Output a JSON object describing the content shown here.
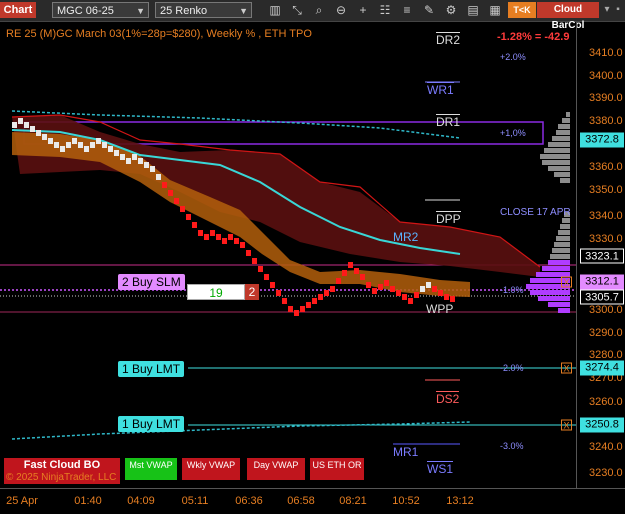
{
  "toolbar": {
    "chart_tab": "Chart",
    "instrument": "MGC 06-25",
    "bar_type": "25 Renko",
    "tko_label": "T<K",
    "cloud_label": "Cloud BarCol",
    "icons": [
      "bar-type-icon",
      "draw-icon",
      "magnifier-icon",
      "zoom-out-icon",
      "add-icon",
      "properties-icon",
      "list-icon",
      "pencil-icon",
      "strategy-icon",
      "templates-icon",
      "grid-icon",
      "chart-trader-icon"
    ]
  },
  "chart": {
    "title": "RE 25 (M)GC March 03(1%=28p=$280), Weekly % , ETH TPO",
    "pct_change": "-1.28% = -42.9",
    "close_label": "CLOSE 17 APR",
    "mr2_label": "MR2",
    "levels": {
      "dr2": "DR2",
      "wr1": "WR1",
      "dr1": "DR1",
      "dpp": "DPP",
      "wpp": "WPP",
      "ds2": "DS2",
      "mr1": "MR1",
      "ws1": "WS1"
    },
    "pct_levels": {
      "p2": "+2.0%",
      "p1": "+1,0%",
      "m1": "-1.0%",
      "m2": "-2.0%",
      "m3": "-3.0%"
    }
  },
  "price_axis": {
    "ticks": [
      "3410.0",
      "3400.0",
      "3390.0",
      "3380.0",
      "3370.0",
      "3360.0",
      "3350.0",
      "3340.0",
      "3330.0",
      "3310.0",
      "3300.0",
      "3290.0",
      "3280.0",
      "3270.0",
      "3260.0",
      "3240.0",
      "3230.0"
    ],
    "boxes": {
      "last": "3372.8",
      "hi": "3323.1",
      "cur": "3312.1",
      "lo": "3305.7",
      "lmt1": "3274.4",
      "lmt2": "3250.8"
    }
  },
  "time_axis": [
    "25 Apr",
    "01:40",
    "04:09",
    "05:11",
    "06:36",
    "06:58",
    "08:21",
    "10:52",
    "13:12"
  ],
  "orders": {
    "slm": "2 Buy SLM",
    "lmt1": "1 Buy LMT",
    "lmt2": "1 Buy LMT",
    "qty": "19",
    "qty_close": "2",
    "x": "X"
  },
  "bottom_buttons": {
    "fast_cloud": "Fast Cloud BO",
    "mst": "Mst VWAP",
    "wkly": "Wkly VWAP",
    "day": "Day VWAP",
    "us_eth": "US ETH OR"
  },
  "copyright": "© 2025 NinjaTrader, LLC",
  "colors": {
    "accent": "#e67e22",
    "bull": "#ffffff",
    "bear": "#ff1a1a",
    "cloud": "#8b1a1a",
    "band": "#c96b0e"
  }
}
